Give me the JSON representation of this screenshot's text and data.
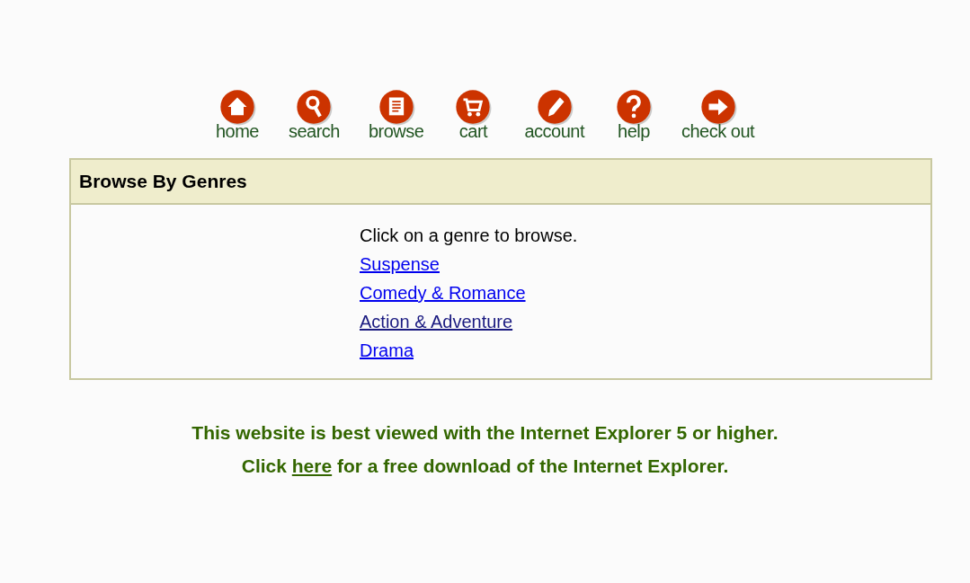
{
  "nav": [
    {
      "kind": "home",
      "label": "home"
    },
    {
      "kind": "search",
      "label": "search"
    },
    {
      "kind": "browse",
      "label": "browse"
    },
    {
      "kind": "cart",
      "label": "cart"
    },
    {
      "kind": "account",
      "label": "account"
    },
    {
      "kind": "help",
      "label": "help"
    },
    {
      "kind": "checkout",
      "label": "check out"
    }
  ],
  "panel": {
    "title": "Browse By Genres",
    "intro": "Click on a genre to browse.",
    "genres": [
      {
        "label": "Suspense",
        "visited": false
      },
      {
        "label": "Comedy & Romance",
        "visited": false
      },
      {
        "label": "Action & Adventure",
        "visited": true
      },
      {
        "label": "Drama",
        "visited": false
      }
    ]
  },
  "footer": {
    "line_1": "This website is best viewed with the Internet Explorer 5 or higher.",
    "line_2_before": "Click",
    "line_2_link": "here",
    "line_2_after": "for a free download of the Internet Explorer."
  }
}
